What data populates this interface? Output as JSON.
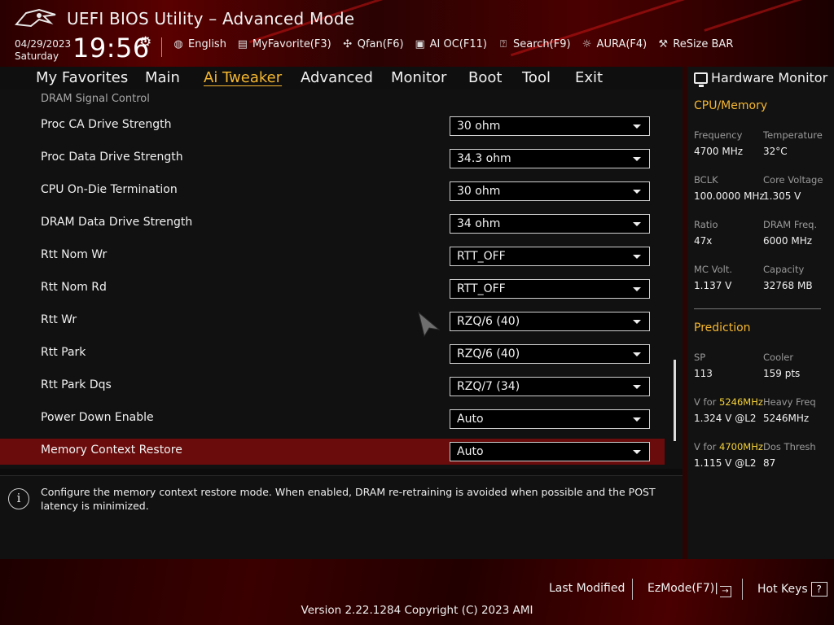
{
  "header": {
    "title": "UEFI BIOS Utility – Advanced Mode",
    "date": "04/29/2023",
    "day": "Saturday",
    "time": "19:56",
    "tools": [
      {
        "label": "English",
        "icon": "globe-icon"
      },
      {
        "label": "MyFavorite(F3)",
        "icon": "favorite-icon"
      },
      {
        "label": "Qfan(F6)",
        "icon": "fan-icon"
      },
      {
        "label": "AI OC(F11)",
        "icon": "chip-icon"
      },
      {
        "label": "Search(F9)",
        "icon": "search-help-icon"
      },
      {
        "label": "AURA(F4)",
        "icon": "aura-light-icon"
      },
      {
        "label": "ReSize BAR",
        "icon": "resize-bar-icon"
      }
    ]
  },
  "menu": {
    "tabs": [
      "My Favorites",
      "Main",
      "Ai Tweaker",
      "Advanced",
      "Monitor",
      "Boot",
      "Tool",
      "Exit"
    ],
    "active": "Ai Tweaker"
  },
  "main": {
    "section": "DRAM Signal Control",
    "settings": [
      {
        "label": "Proc CA Drive Strength",
        "value": "30 ohm"
      },
      {
        "label": "Proc Data Drive Strength",
        "value": "34.3 ohm"
      },
      {
        "label": "CPU On-Die Termination",
        "value": "30 ohm"
      },
      {
        "label": "DRAM Data Drive Strength",
        "value": "34 ohm"
      },
      {
        "label": "Rtt Nom Wr",
        "value": "RTT_OFF"
      },
      {
        "label": "Rtt Nom Rd",
        "value": "RTT_OFF"
      },
      {
        "label": "Rtt Wr",
        "value": "RZQ/6 (40)"
      },
      {
        "label": "Rtt Park",
        "value": "RZQ/6 (40)"
      },
      {
        "label": "Rtt Park Dqs",
        "value": "RZQ/7 (34)"
      },
      {
        "label": "Power Down Enable",
        "value": "Auto"
      },
      {
        "label": "Memory Context Restore",
        "value": "Auto"
      }
    ],
    "selected_index": 10
  },
  "help": {
    "text": "Configure the memory context restore mode. When enabled, DRAM re-retraining is avoided when possible and the POST latency is minimized."
  },
  "hardware_monitor": {
    "title": "Hardware Monitor",
    "cpu_memory": {
      "title": "CPU/Memory",
      "frequency_label": "Frequency",
      "frequency": "4700 MHz",
      "temperature_label": "Temperature",
      "temperature": "32°C",
      "bclk_label": "BCLK",
      "bclk": "100.0000 MHz",
      "core_voltage_label": "Core Voltage",
      "core_voltage": "1.305 V",
      "ratio_label": "Ratio",
      "ratio": "47x",
      "dram_freq_label": "DRAM Freq.",
      "dram_freq": "6000 MHz",
      "mc_volt_label": "MC Volt.",
      "mc_volt": "1.137 V",
      "capacity_label": "Capacity",
      "capacity": "32768 MB"
    },
    "prediction": {
      "title": "Prediction",
      "sp_label": "SP",
      "sp": "113",
      "cooler_label": "Cooler",
      "cooler": "159 pts",
      "v_for_1_prefix": "V for ",
      "v_for_1_freq": "5246MHz",
      "v_for_1": "1.324 V @L2",
      "heavy_freq_label": "Heavy Freq",
      "heavy_freq": "5246MHz",
      "v_for_2_prefix": "V for ",
      "v_for_2_freq": "4700MHz",
      "v_for_2": "1.115 V @L2",
      "dos_thresh_label": "Dos Thresh",
      "dos_thresh": "87"
    }
  },
  "footer": {
    "last_modified": "Last Modified",
    "ezmode": "EzMode(F7)|",
    "hot_keys": "Hot Keys",
    "hot_keys_key": "?",
    "version": "Version 2.22.1284 Copyright (C) 2023 AMI"
  },
  "colors": {
    "accent": "#f5b731",
    "selected_row": "#6a0c0c",
    "highlight": "#f5d23a"
  }
}
